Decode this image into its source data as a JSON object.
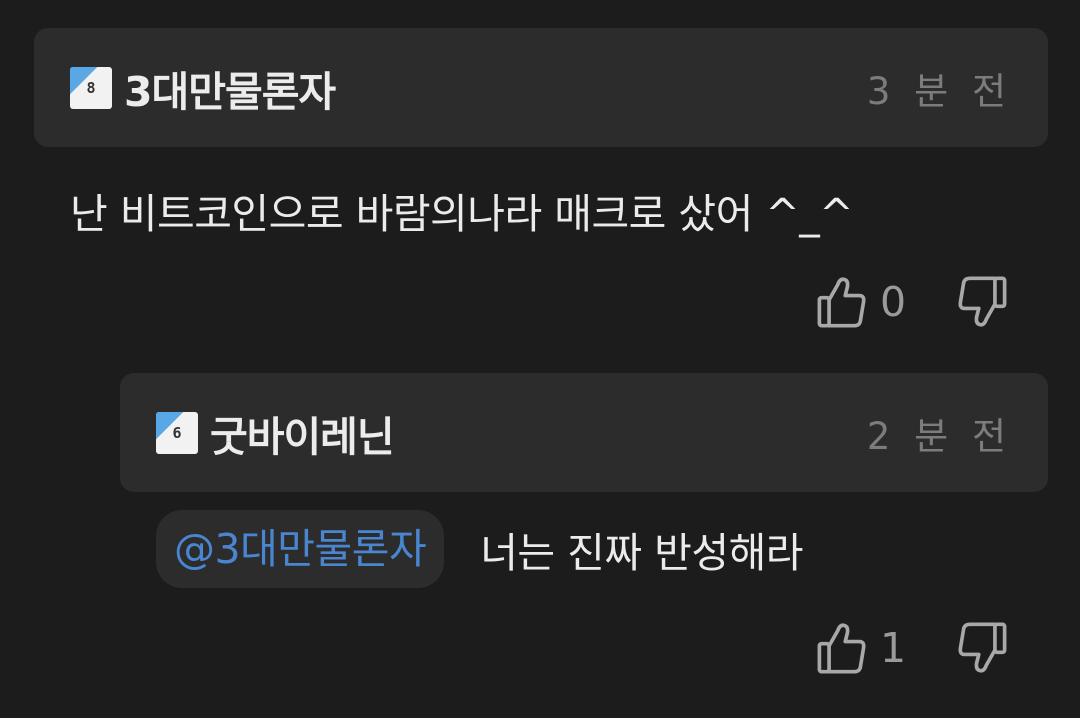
{
  "comments": [
    {
      "level": "8",
      "username": "3대만물론자",
      "time": "3 분 전",
      "text": "난 비트코인으로 바람의나라 매크로 샀어 ^_^",
      "likes": "0"
    },
    {
      "level": "6",
      "username": "굿바이레닌",
      "time": "2 분 전",
      "mention": "@3대만물론자",
      "text": "너는 진짜 반성해라",
      "likes": "1"
    }
  ],
  "icons": {
    "like": "thumbs-up-icon",
    "dislike": "thumbs-down-icon"
  },
  "colors": {
    "background": "#1c1c1d",
    "card": "#2c2c2d",
    "mention": "#4a86cf",
    "badge_accent": "#5aa7e6"
  }
}
